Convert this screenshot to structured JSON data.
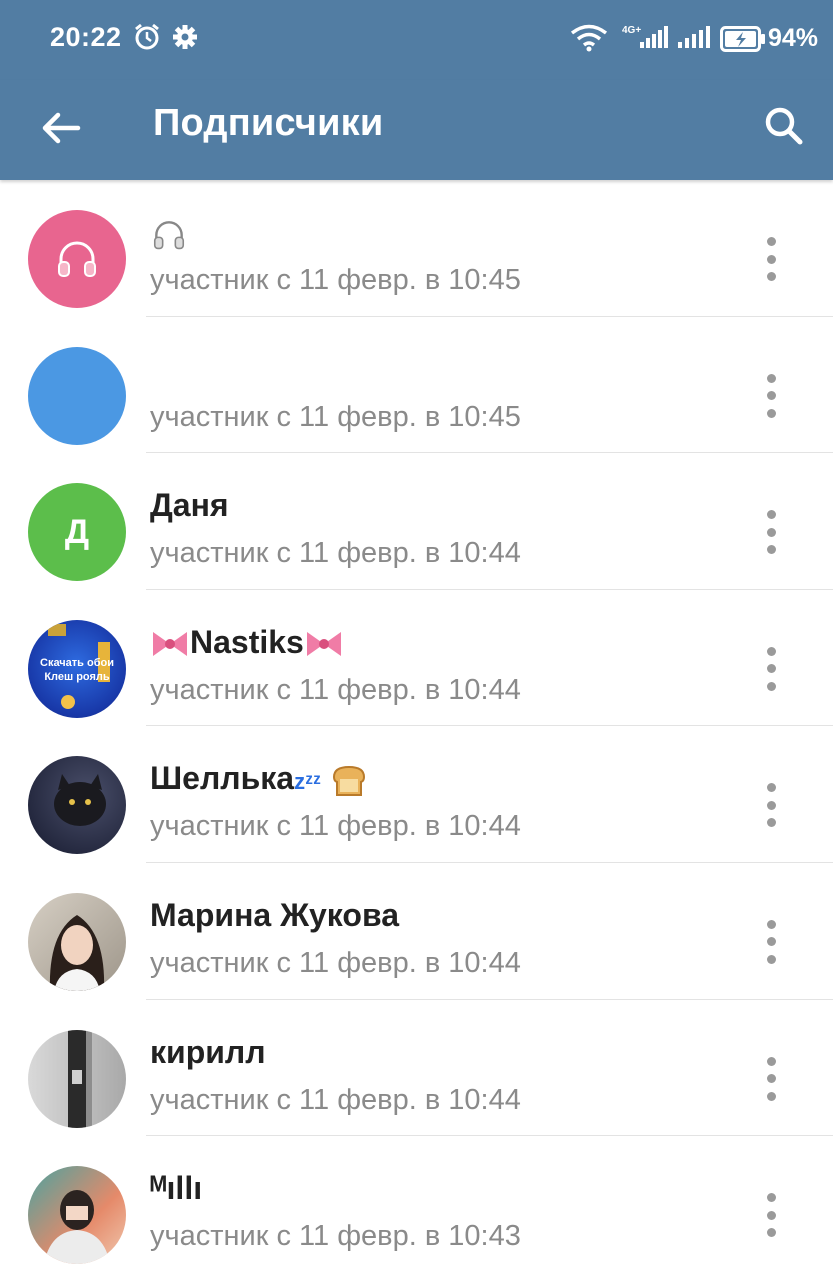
{
  "status_bar": {
    "time": "20:22",
    "battery_percent": "94%"
  },
  "app_bar": {
    "title": "Подписчики"
  },
  "members": [
    {
      "name": "",
      "name_icons": [
        "headphones-icon"
      ],
      "status": "участник с 11 февр. в 10:45",
      "avatar_color": "#e8658f",
      "avatar_icon": "headphones-icon"
    },
    {
      "name": "",
      "name_icons": [],
      "status": "участник с 11 февр. в 10:45",
      "avatar_color": "#4b98e3"
    },
    {
      "name": "Даня",
      "status": "участник с 11 февр. в 10:44",
      "avatar_color": "#5cbe4b",
      "avatar_letter": "Д"
    },
    {
      "name": "Nastiks",
      "name_icons": [
        "bow-icon",
        "bow-icon"
      ],
      "status": "участник с 11 февр. в 10:44",
      "avatar_color": "#1f3fbf",
      "avatar_photo_text": "Скачать обои Клеш рояль"
    },
    {
      "name": "Шеллька",
      "name_suffix": "zᶻᶻ",
      "name_icons": [
        "bread-icon"
      ],
      "status": "участник с 11 февр. в 10:44",
      "avatar_color": "#2b2f4a"
    },
    {
      "name": "Марина Жукова",
      "status": "участник с 11 февр. в 10:44",
      "avatar_color": "#c7b8a8"
    },
    {
      "name": "кирилл",
      "status": "участник с 11 февр. в 10:44",
      "avatar_color": "#b9b9b9"
    },
    {
      "name": "ᴹıllı",
      "status": "участник с 11 февр. в 10:43",
      "avatar_color": "#e58a6a"
    }
  ]
}
